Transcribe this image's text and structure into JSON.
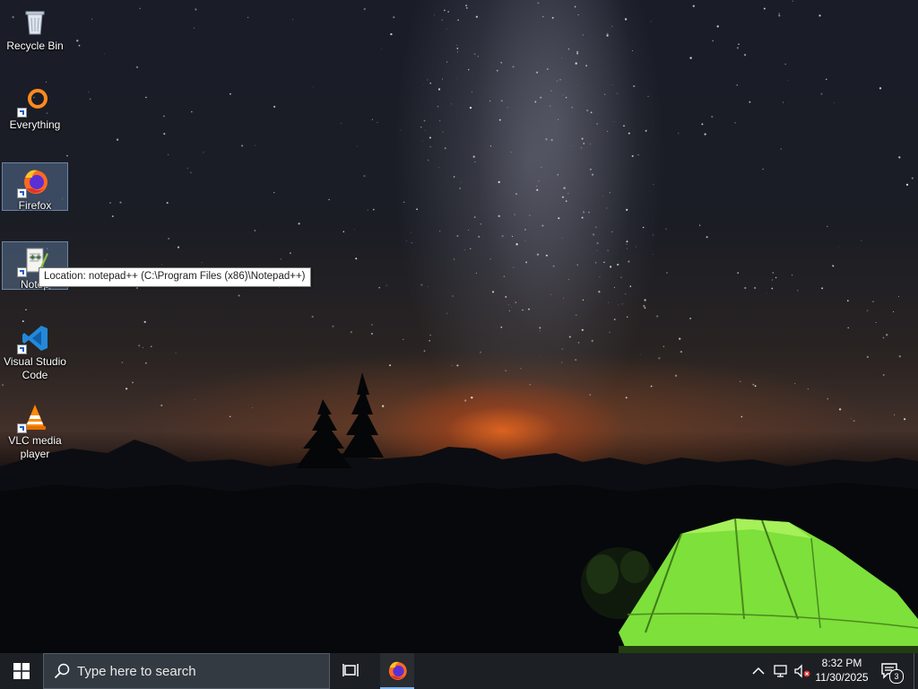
{
  "desktop": {
    "icons": [
      {
        "label": "Recycle Bin",
        "icon": "recycle-bin-icon"
      },
      {
        "label": "Everything",
        "icon": "everything-search-icon"
      },
      {
        "label": "Firefox",
        "icon": "firefox-icon"
      },
      {
        "label": "Notepad++",
        "icon": "notepad-plus-plus-icon"
      },
      {
        "label": "Visual Studio Code",
        "icon": "vscode-icon"
      },
      {
        "label": "VLC media player",
        "icon": "vlc-icon"
      }
    ],
    "tooltip": "Location: notepad++ (C:\\Program Files (x86)\\Notepad++)",
    "notepad_visible_label": "Notep"
  },
  "taskbar": {
    "search_placeholder": "Type here to search",
    "pinned": [
      {
        "name": "Firefox",
        "icon": "firefox-icon",
        "active": true
      }
    ],
    "tray_icons": [
      "chevron-up-icon",
      "network-icon",
      "volume-muted-icon"
    ],
    "time": "8:32 PM",
    "date": "11/30/2025",
    "notification_count": "3"
  },
  "colors": {
    "taskbar_bg": "#1c1f24",
    "search_bg": "#343a42",
    "active_indicator": "#7fb6ef",
    "tent_green": "#7ee03a",
    "horizon_orange": "#ff6e1e"
  }
}
